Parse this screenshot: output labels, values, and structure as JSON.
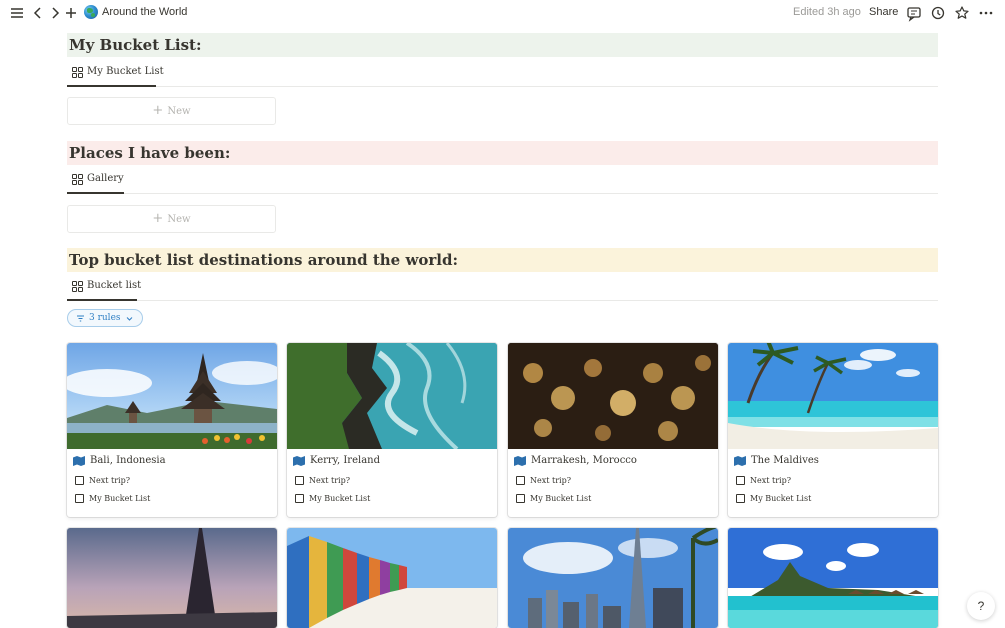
{
  "topbar": {
    "page_title": "Around the World",
    "edited": "Edited 3h ago",
    "share_label": "Share",
    "icons": [
      "menu-icon",
      "back-icon",
      "forward-icon",
      "add-icon",
      "globe-icon",
      "comments-icon",
      "history-icon",
      "star-icon",
      "more-icon"
    ]
  },
  "sections": [
    {
      "heading": "My Bucket List:",
      "view_tab": "My Bucket List",
      "new_label": "New",
      "color": "#edf3ec"
    },
    {
      "heading": "Places I have been:",
      "view_tab": "Gallery",
      "new_label": "New",
      "color": "#fbecea"
    },
    {
      "heading": "Top bucket list destinations around the world:",
      "view_tab": "Bucket list",
      "color": "#fbf3db"
    }
  ],
  "filter": {
    "rules_label": "3 rules"
  },
  "cards": [
    {
      "title": "Bali, Indonesia",
      "prop1": "Next trip?",
      "prop2": "My Bucket List"
    },
    {
      "title": "Kerry, Ireland",
      "prop1": "Next trip?",
      "prop2": "My Bucket List"
    },
    {
      "title": "Marrakesh, Morocco",
      "prop1": "Next trip?",
      "prop2": "My Bucket List"
    },
    {
      "title": "The Maldives",
      "prop1": "Next trip?",
      "prop2": "My Bucket List"
    }
  ],
  "second_row_cards": [
    "paris-photo",
    "beach-huts-photo",
    "dubai-photo",
    "bora-bora-photo"
  ],
  "help": {
    "label": "?"
  },
  "colors": {
    "accent_blue": "#2f7fc4",
    "text": "#37352f",
    "muted": "#9b9a97"
  }
}
